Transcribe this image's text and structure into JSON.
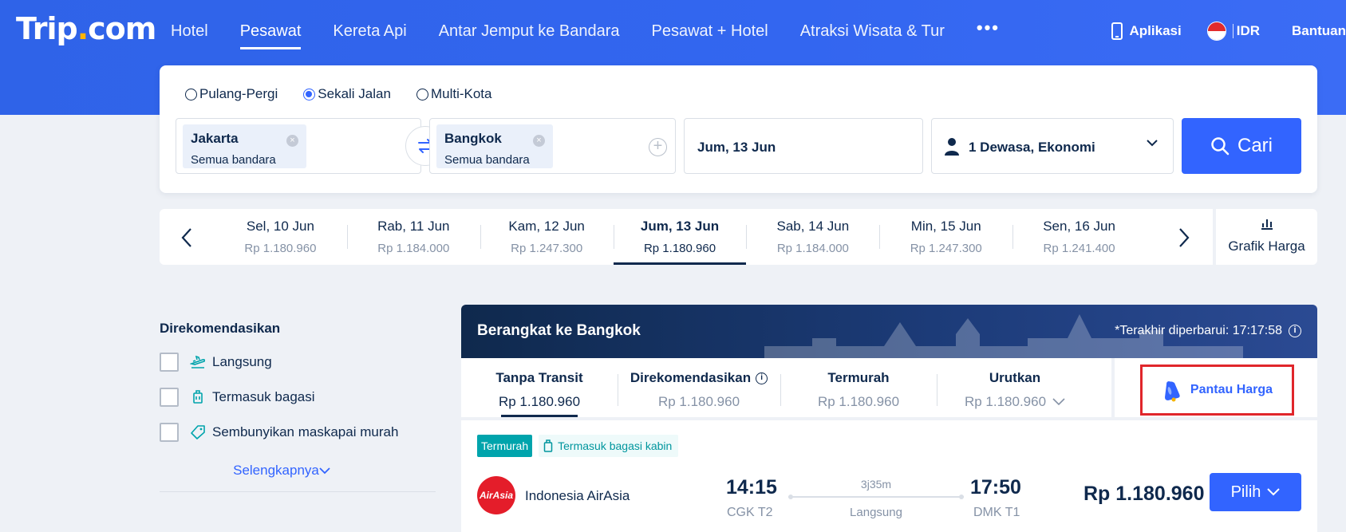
{
  "brand": {
    "logo_main": "Trip",
    "logo_dot": ".",
    "logo_tail": "com"
  },
  "nav": {
    "items": [
      "Hotel",
      "Pesawat",
      "Kereta Api",
      "Antar Jemput ke Bandara",
      "Pesawat + Hotel",
      "Atraksi Wisata & Tur"
    ],
    "active": "Pesawat",
    "more": "•••"
  },
  "right_nav": {
    "app": "Aplikasi",
    "currency": "IDR",
    "help": "Bantuan"
  },
  "search": {
    "trip_types": [
      "Pulang-Pergi",
      "Sekali Jalan",
      "Multi-Kota"
    ],
    "selected_trip_type": "Sekali Jalan",
    "from": {
      "city": "Jakarta",
      "sub": "Semua bandara"
    },
    "to": {
      "city": "Bangkok",
      "sub": "Semua bandara"
    },
    "date": "Jum, 13 Jun",
    "passengers": "1 Dewasa, Ekonomi",
    "button": "Cari"
  },
  "date_strip": {
    "days": [
      {
        "date": "Sel, 10 Jun",
        "price": "Rp 1.180.960"
      },
      {
        "date": "Rab, 11 Jun",
        "price": "Rp 1.184.000"
      },
      {
        "date": "Kam, 12 Jun",
        "price": "Rp 1.247.300"
      },
      {
        "date": "Jum, 13 Jun",
        "price": "Rp 1.180.960"
      },
      {
        "date": "Sab, 14 Jun",
        "price": "Rp 1.184.000"
      },
      {
        "date": "Min, 15 Jun",
        "price": "Rp 1.247.300"
      },
      {
        "date": "Sen, 16 Jun",
        "price": "Rp 1.241.400"
      }
    ],
    "selected_index": 3,
    "chart_label": "Grafik Harga"
  },
  "filters": {
    "title": "Direkomendasikan",
    "options": [
      "Langsung",
      "Termasuk bagasi",
      "Sembunyikan maskapai murah"
    ],
    "more": "Selengkapnya"
  },
  "results": {
    "title": "Berangkat ke Bangkok",
    "updated": "*Terakhir diperbarui: 17:17:58",
    "sort_tabs": [
      {
        "label": "Tanpa Transit",
        "price": "Rp 1.180.960"
      },
      {
        "label": "Direkomendasikan",
        "price": "Rp 1.180.960"
      },
      {
        "label": "Termurah",
        "price": "Rp 1.180.960"
      },
      {
        "label": "Urutkan",
        "price": "Rp 1.180.960"
      }
    ],
    "active_sort": "Tanpa Transit",
    "price_alert": "Pantau Harga"
  },
  "flight": {
    "tag_cheapest": "Termurah",
    "tag_baggage": "Termasuk bagasi kabin",
    "airline": "Indonesia AirAsia",
    "airline_logo_text": "AirAsia",
    "depart_time": "14:15",
    "depart_code": "CGK T2",
    "duration": "3j35m",
    "stops": "Langsung",
    "arrive_time": "17:50",
    "arrive_code": "DMK T1",
    "price": "Rp 1.180.960",
    "select": "Pilih"
  },
  "colors": {
    "primary": "#3264ff",
    "navy": "#0f294d",
    "teal": "#00a4ac",
    "alert_border": "#e0262b"
  }
}
